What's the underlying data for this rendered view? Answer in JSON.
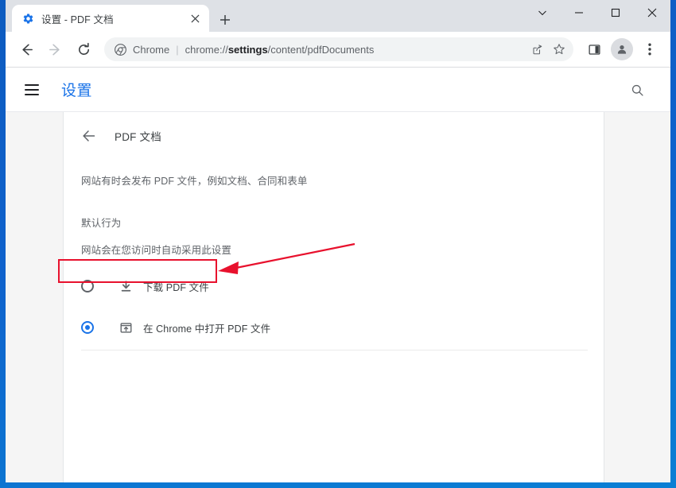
{
  "browser": {
    "tab": {
      "title": "设置 - PDF 文档",
      "favicon": "gear-icon",
      "close_label": "×"
    },
    "new_tab_label": "+",
    "window_controls": {
      "expand": "chevron-down-icon",
      "minimize": "minimize-icon",
      "maximize": "maximize-icon",
      "close": "close-icon"
    },
    "nav": {
      "back": "back-arrow-icon",
      "forward": "forward-arrow-icon",
      "reload": "reload-icon"
    },
    "omnibox": {
      "site_icon": "chrome-logo-icon",
      "scheme_label": "Chrome",
      "separator": "|",
      "url_prefix": "chrome://",
      "url_bold": "settings",
      "url_suffix": "/content/pdfDocuments",
      "full_url": "chrome://settings/content/pdfDocuments",
      "share_icon": "share-icon",
      "bookmark_icon": "star-icon"
    },
    "toolbar": {
      "side_panel_icon": "side-panel-icon",
      "profile_icon": "avatar-icon",
      "menu_icon": "three-dot-menu-icon"
    }
  },
  "settings": {
    "menu_icon": "hamburger-menu-icon",
    "title": "设置",
    "search_icon": "search-icon",
    "subpage": {
      "back_icon": "back-arrow-icon",
      "title": "PDF 文档",
      "description": "网站有时会发布 PDF 文件，例如文档、合同和表单",
      "section_label": "默认行为",
      "section_sub": "网站会在您访问时自动采用此设置",
      "options": [
        {
          "id": "download-pdf",
          "icon": "download-icon",
          "label": "下载 PDF 文件",
          "selected": false
        },
        {
          "id": "open-in-chrome",
          "icon": "open-in-browser-icon",
          "label": "在 Chrome 中打开 PDF 文件",
          "selected": true
        }
      ]
    }
  },
  "annotation": {
    "highlight_box": "red-rectangle-around-download-pdf-option",
    "arrow": "red-arrow-pointing-to-download-pdf-option",
    "color": "#e8112d"
  },
  "colors": {
    "accent": "#1a73e8",
    "window_border": "#0d5bbf",
    "tabstrip": "#dee1e6",
    "annotation_red": "#e8112d"
  }
}
